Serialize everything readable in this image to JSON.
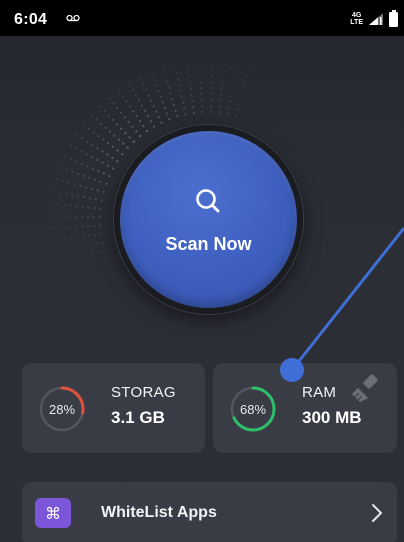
{
  "status_bar": {
    "time": "6:04",
    "network_label_top": "4G",
    "network_label_bottom": "LTE",
    "icons": [
      "voicemail-icon",
      "signal-icon",
      "battery-icon"
    ]
  },
  "scan": {
    "label": "Scan Now",
    "icon": "search-icon",
    "color": "#3e5fbf"
  },
  "stats": {
    "storage": {
      "title": "STORAG",
      "value": "3.1 GB",
      "percent_label": "28%",
      "percent": 28,
      "color": "#e0523a"
    },
    "ram": {
      "title": "RAM",
      "value": "300 MB",
      "percent_label": "68%",
      "percent": 68,
      "color": "#2fbf6a",
      "icon": "brush-icon"
    }
  },
  "whitelist": {
    "label": "WhiteList Apps",
    "icon": "command-icon",
    "icon_glyph": "⌘",
    "icon_color": "#7c56d9",
    "chevron": "chevron-right-icon"
  },
  "annotation": {
    "color": "#3f6fd6"
  }
}
